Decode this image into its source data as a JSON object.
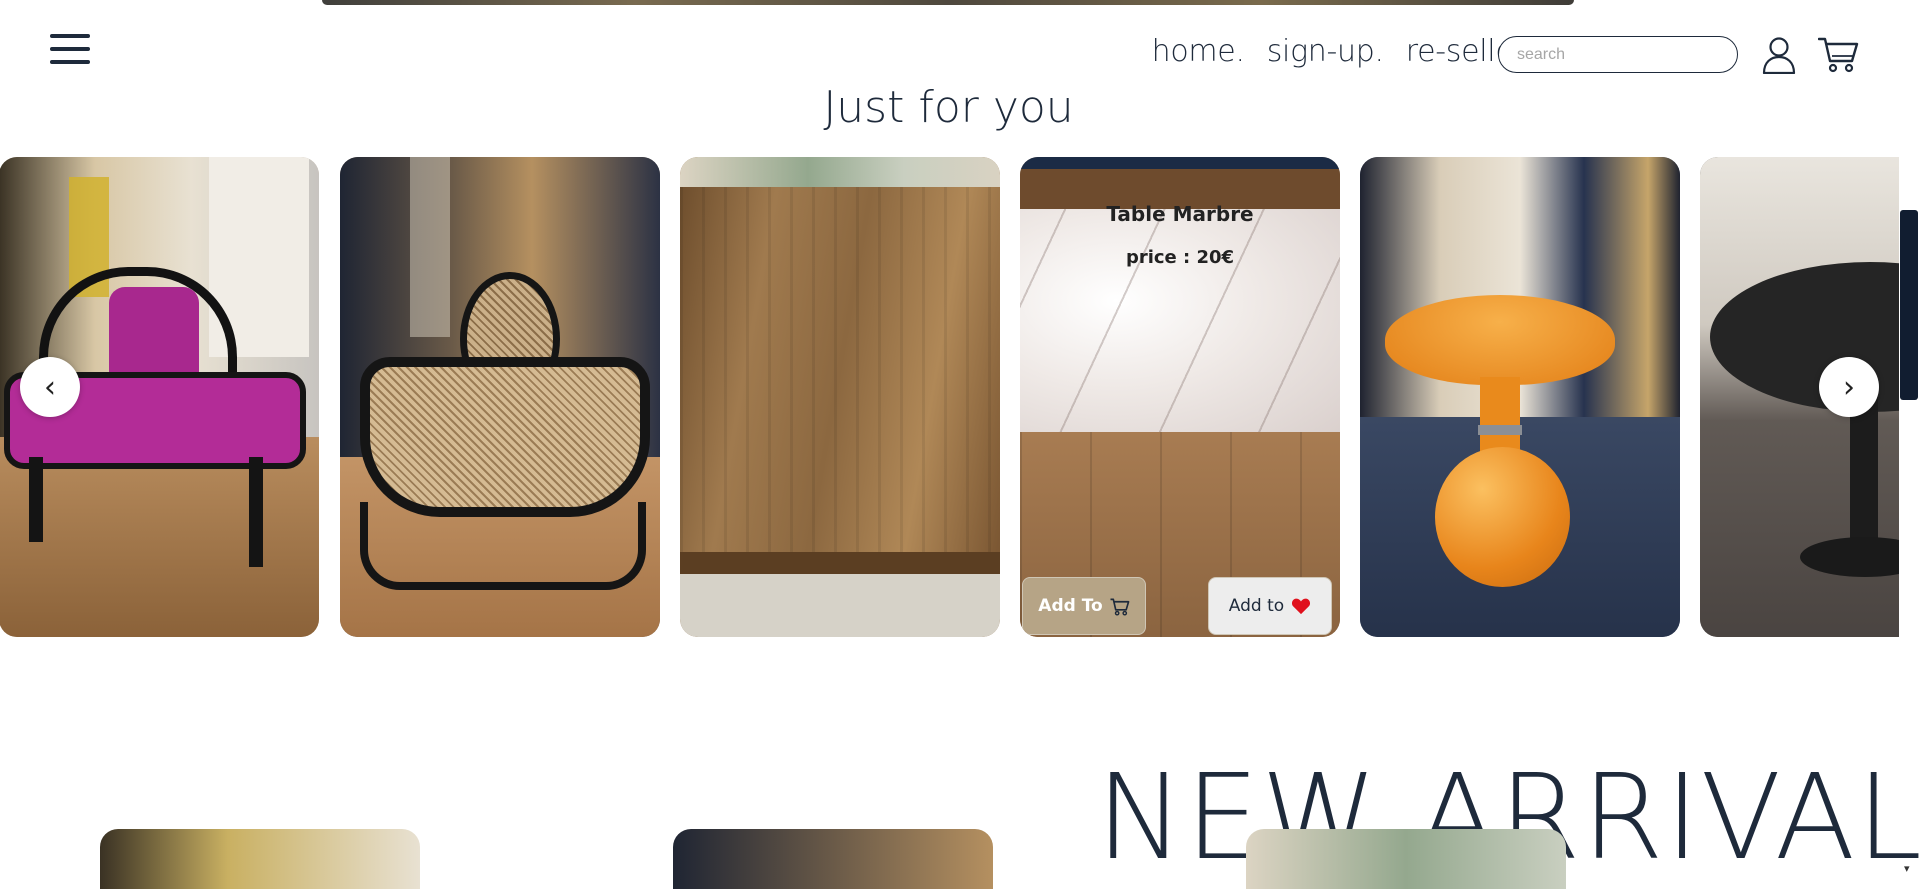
{
  "nav": {
    "links": [
      "home.",
      "sign-up.",
      "re-seller."
    ],
    "search_placeholder": "search"
  },
  "section_title": "Just for you",
  "carousel": {
    "prev": "‹",
    "next": "›",
    "active_product": {
      "title": "Table Marbre",
      "price": "price : 20€",
      "add_cart_label": "Add To",
      "add_fav_label": "Add to"
    }
  },
  "arrivals_title": "NEW ARRIVALS",
  "colors": {
    "text": "#1e2a3b",
    "cart_button": "#b6a486",
    "fav_heart": "#e0101c",
    "scroll_thumb": "#111d30"
  },
  "icons": [
    "menu-icon",
    "user-icon",
    "cart-icon",
    "heart-icon",
    "chevron-left-icon",
    "chevron-right-icon"
  ]
}
